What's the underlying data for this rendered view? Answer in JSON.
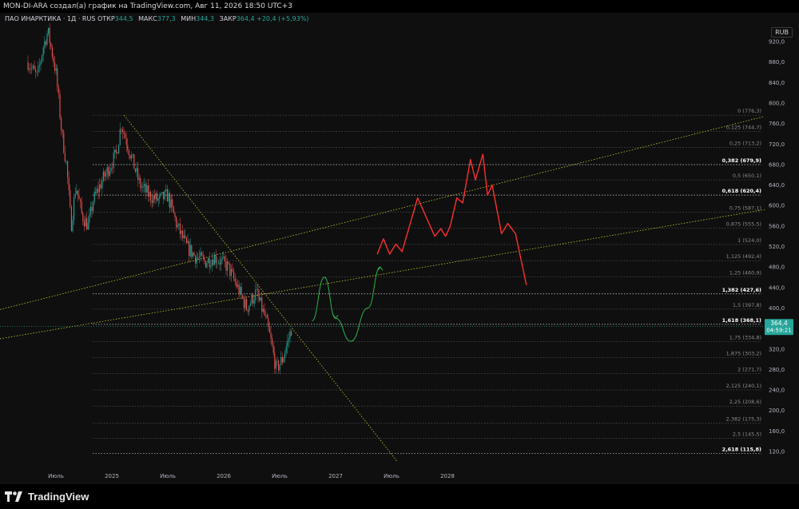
{
  "header": {
    "title": "MON-DI-ARA создал(а) график на TradingView.com, Авг 11, 2026 18:50 UTC+3"
  },
  "legend": {
    "symbol": "ПАО ИНАРКТИКА · 1Д · RUS",
    "open_label": "ОТКР",
    "open_value": "344,5",
    "high_label": "МАКС",
    "high_value": "377,3",
    "low_label": "МИН",
    "low_value": "344,3",
    "close_label": "ЗАКР",
    "close_value": "364,4 +20,4 (+5,93%)"
  },
  "currency": "RUB",
  "price_badge": {
    "value": "364,4",
    "timer": "04:59:21"
  },
  "brand": {
    "name": "TradingView"
  },
  "colors": {
    "up": "#26a69a",
    "down": "#ef5350",
    "projection_red": "#ff2e2e",
    "projection_green": "#2bb24c",
    "trendline": "#c8c832",
    "fib_line": "#6e6e6e"
  },
  "chart_data": {
    "type": "candlestick",
    "title": "",
    "x_axis": {
      "tick_labels": [
        "Июль",
        "2025",
        "Июль",
        "2026",
        "Июль",
        "2027",
        "Июль",
        "2028"
      ],
      "range": [
        "2024-04",
        "2028-12"
      ]
    },
    "y_axis": {
      "range": [
        100,
        960
      ],
      "tick_labels": [
        "920,0",
        "880,0",
        "840,0",
        "800,0",
        "760,0",
        "720,0",
        "680,0",
        "640,0",
        "600,0",
        "560,0",
        "520,0",
        "480,0",
        "440,0",
        "400,0",
        "360,0",
        "320,0",
        "280,0",
        "240,0",
        "200,0",
        "160,0",
        "120,0"
      ],
      "tick_values": [
        920,
        880,
        840,
        800,
        760,
        720,
        680,
        640,
        600,
        560,
        520,
        480,
        440,
        400,
        360,
        320,
        280,
        240,
        200,
        160,
        120
      ]
    },
    "price_path": [
      [
        "2024-04-01",
        880
      ],
      [
        "2024-05-01",
        850
      ],
      [
        "2024-05-20",
        910
      ],
      [
        "2024-06-05",
        940
      ],
      [
        "2024-07-01",
        860
      ],
      [
        "2024-07-20",
        740
      ],
      [
        "2024-08-05",
        680
      ],
      [
        "2024-08-20",
        560
      ],
      [
        "2024-09-05",
        640
      ],
      [
        "2024-09-25",
        580
      ],
      [
        "2024-10-15",
        560
      ],
      [
        "2024-11-01",
        610
      ],
      [
        "2024-12-01",
        650
      ],
      [
        "2025-01-15",
        700
      ],
      [
        "2025-02-01",
        760
      ],
      [
        "2025-03-01",
        700
      ],
      [
        "2025-04-01",
        640
      ],
      [
        "2025-05-01",
        620
      ],
      [
        "2025-06-01",
        610
      ],
      [
        "2025-07-01",
        620
      ],
      [
        "2025-08-01",
        560
      ],
      [
        "2025-09-01",
        520
      ],
      [
        "2025-10-01",
        500
      ],
      [
        "2025-11-01",
        490
      ],
      [
        "2025-12-01",
        500
      ],
      [
        "2026-01-15",
        480
      ],
      [
        "2026-02-15",
        440
      ],
      [
        "2026-03-15",
        400
      ],
      [
        "2026-04-15",
        430
      ],
      [
        "2026-05-15",
        380
      ],
      [
        "2026-06-01",
        340
      ],
      [
        "2026-06-20",
        280
      ],
      [
        "2026-07-10",
        300
      ],
      [
        "2026-07-25",
        330
      ],
      [
        "2026-08-11",
        364.4
      ]
    ],
    "fib_levels": [
      {
        "ratio": "0",
        "value": 776.3,
        "bold": false
      },
      {
        "ratio": "0,125",
        "value": 744.7,
        "bold": false
      },
      {
        "ratio": "0,25",
        "value": 713.2,
        "bold": false
      },
      {
        "ratio": "0,382",
        "value": 679.9,
        "bold": true
      },
      {
        "ratio": "0,5",
        "value": 650.1,
        "bold": false
      },
      {
        "ratio": "0,618",
        "value": 620.4,
        "bold": true
      },
      {
        "ratio": "0,75",
        "value": 587.1,
        "bold": false
      },
      {
        "ratio": "0,875",
        "value": 555.5,
        "bold": false
      },
      {
        "ratio": "1",
        "value": 524.0,
        "bold": false
      },
      {
        "ratio": "1,125",
        "value": 492.4,
        "bold": false
      },
      {
        "ratio": "1,25",
        "value": 460.9,
        "bold": false
      },
      {
        "ratio": "1,382",
        "value": 427.6,
        "bold": true
      },
      {
        "ratio": "1,5",
        "value": 397.8,
        "bold": false
      },
      {
        "ratio": "1,618",
        "value": 368.1,
        "bold": true
      },
      {
        "ratio": "1,75",
        "value": 334.8,
        "bold": false
      },
      {
        "ratio": "1,875",
        "value": 303.2,
        "bold": false
      },
      {
        "ratio": "2",
        "value": 271.7,
        "bold": false
      },
      {
        "ratio": "2,125",
        "value": 240.1,
        "bold": false
      },
      {
        "ratio": "2,25",
        "value": 208.6,
        "bold": false
      },
      {
        "ratio": "2,382",
        "value": 175.3,
        "bold": false
      },
      {
        "ratio": "2,5",
        "value": 145.5,
        "bold": false
      },
      {
        "ratio": "2,618",
        "value": 115.8,
        "bold": true
      }
    ],
    "red_projection": [
      [
        "2027-05-15",
        505
      ],
      [
        "2027-06-05",
        535
      ],
      [
        "2027-06-25",
        505
      ],
      [
        "2027-07-15",
        525
      ],
      [
        "2027-08-05",
        510
      ],
      [
        "2027-09-25",
        615
      ],
      [
        "2027-11-20",
        540
      ],
      [
        "2027-12-10",
        555
      ],
      [
        "2027-12-25",
        540
      ],
      [
        "2028-01-10",
        560
      ],
      [
        "2028-02-01",
        615
      ],
      [
        "2028-02-20",
        605
      ],
      [
        "2028-03-15",
        690
      ],
      [
        "2028-04-01",
        650
      ],
      [
        "2028-04-25",
        700
      ],
      [
        "2028-05-10",
        620
      ],
      [
        "2028-05-25",
        640
      ],
      [
        "2028-06-25",
        545
      ],
      [
        "2028-07-15",
        565
      ],
      [
        "2028-08-10",
        545
      ],
      [
        "2028-09-15",
        445
      ]
    ],
    "green_projection": [
      [
        "2026-10-15",
        375
      ],
      [
        "2026-11-25",
        460
      ],
      [
        "2027-01-01",
        380
      ],
      [
        "2027-02-20",
        335
      ],
      [
        "2027-04-15",
        400
      ],
      [
        "2027-05-25",
        480
      ]
    ]
  }
}
